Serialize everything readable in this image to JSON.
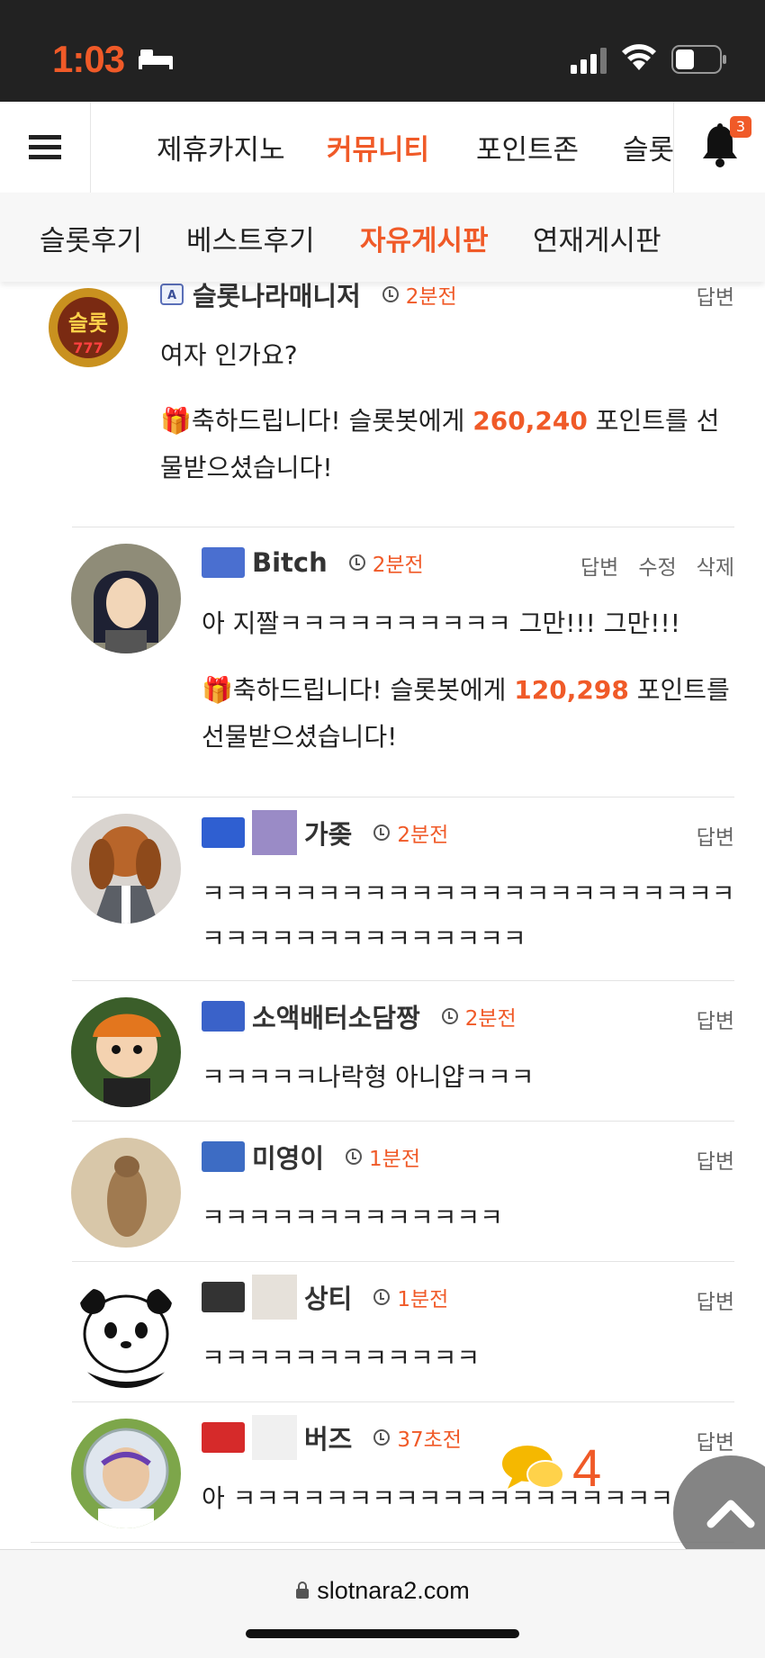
{
  "status": {
    "time": "1:03"
  },
  "nav": {
    "items": [
      {
        "label": "제휴카지노"
      },
      {
        "label": "커뮤니티"
      },
      {
        "label": "포인트존"
      },
      {
        "label": "슬롯"
      }
    ],
    "notification_count": "3"
  },
  "subnav": {
    "items": [
      {
        "label": "슬롯후기"
      },
      {
        "label": "베스트후기"
      },
      {
        "label": "자유게시판"
      },
      {
        "label": "연재게시판"
      }
    ]
  },
  "comments": [
    {
      "user": "슬롯나라매니저",
      "time": "2분전",
      "reply": "답변",
      "text": "여자 인가요?",
      "gift_pre": "축하드립니다! 슬롯봇에게 ",
      "gift_points": "260,240",
      "gift_post1": " 포인트를 선",
      "gift_post2": "물받으셨습니다!"
    },
    {
      "user": "Bitch",
      "time": "2분전",
      "reply": "답변",
      "edit": "수정",
      "delete": "삭제",
      "text": "아 지짤ㅋㅋㅋㅋㅋㅋㅋㅋㅋㅋ 그만!!! 그만!!!",
      "gift_pre": "축하드립니다! 슬롯봇에게 ",
      "gift_points": "120,298",
      "gift_post1": " 포인트를",
      "gift_post2": "선물받으셨습니다!"
    },
    {
      "user": "가좆",
      "time": "2분전",
      "reply": "답변",
      "text1": "ㅋㅋㅋㅋㅋㅋㅋㅋㅋㅋㅋㅋㅋㅋㅋㅋㅋㅋㅋㅋㅋㅋㅋ",
      "text2": "ㅋㅋㅋㅋㅋㅋㅋㅋㅋㅋㅋㅋㅋㅋ"
    },
    {
      "user": "소액배터소담짱",
      "time": "2분전",
      "reply": "답변",
      "text": "ㅋㅋㅋㅋㅋ나락형 아니얍ㅋㅋㅋ"
    },
    {
      "user": "미영이",
      "time": "1분전",
      "reply": "답변",
      "text": "ㅋㅋㅋㅋㅋㅋㅋㅋㅋㅋㅋㅋㅋ"
    },
    {
      "user": "상티",
      "time": "1분전",
      "reply": "답변",
      "text": "ㅋㅋㅋㅋㅋㅋㅋㅋㅋㅋㅋㅋ"
    },
    {
      "user": "버즈",
      "time": "37초전",
      "reply": "답변",
      "text": "아 ㅋㅋㅋㅋㅋㅋㅋㅋㅋㅋㅋㅋㅋㅋㅋㅋㅋㅋㅋ"
    }
  ],
  "floating": {
    "chat_count": "4"
  },
  "url": {
    "domain": "slotnara2.com"
  },
  "colors": {
    "accent": "#f05a28",
    "statusbar": "#222222"
  }
}
